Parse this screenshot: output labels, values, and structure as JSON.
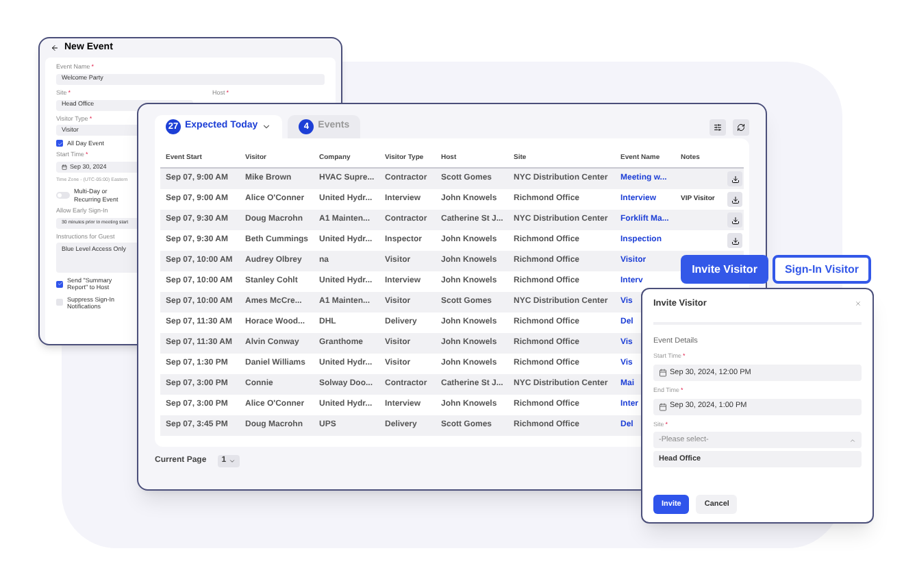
{
  "new_event": {
    "title": "New Event",
    "fields": [
      {
        "kind": "input",
        "label": "Event Name",
        "req": "*",
        "value": "Welcome Party"
      },
      {
        "kind": "pair",
        "label": "Site",
        "req": "*",
        "value": "Head Office",
        "label_2": "Host",
        "req_2": "*"
      },
      {
        "kind": "input",
        "label": "Visitor Type",
        "req": "*",
        "value": "Visitor"
      },
      {
        "kind": "checkbox",
        "label": "All Day Event",
        "checked": true
      },
      {
        "kind": "date",
        "label": "Start Time",
        "req": "*",
        "value": "Sep 30, 2024"
      },
      {
        "kind": "note",
        "label": "Time Zone - (UTC-05:00) Eastern"
      },
      {
        "kind": "toggle",
        "label": "Multi-Day or Recurring Event",
        "on": false
      },
      {
        "kind": "input",
        "label": "Allow Early Sign-In",
        "value": "30 minutes prior to meeting start"
      },
      {
        "kind": "textarea",
        "label": "Instructions for Guest",
        "value": "Blue Level Access Only"
      },
      {
        "kind": "checkbox",
        "label": "Send \"Summary Report\" to Host",
        "checked": true
      },
      {
        "kind": "checkbox",
        "label": "Suppress Sign-In Notifications",
        "checked": false
      }
    ]
  },
  "events_table": {
    "tabs": [
      {
        "count": "27",
        "label": "Expected Today",
        "selected": true
      },
      {
        "count": "4",
        "label": "Events",
        "selected": false
      }
    ],
    "columns": [
      "Event Start",
      "Visitor",
      "Company",
      "Visitor Type",
      "Host",
      "Site",
      "Event Name",
      "Notes"
    ],
    "rows": [
      {
        "cells": [
          "Sep 07, 9:00 AM",
          "Mike Brown",
          "HVAC Supre...",
          "Contractor",
          "Scott Gomes",
          "NYC Distribution Center",
          "Meeting w...",
          ""
        ],
        "download": true
      },
      {
        "cells": [
          "Sep 07, 9:00 AM",
          "Alice O'Conner",
          "United Hydr...",
          "Interview",
          "John Knowels",
          "Richmond Office",
          "Interview",
          "VIP Visitor"
        ],
        "download": true
      },
      {
        "cells": [
          "Sep 07, 9:30 AM",
          "Doug Macrohn",
          "A1 Mainten...",
          "Contractor",
          "Catherine St J...",
          "NYC Distribution Center",
          "Forklift Ma...",
          ""
        ],
        "download": true
      },
      {
        "cells": [
          "Sep 07, 9:30 AM",
          "Beth Cummings",
          "United Hydr...",
          "Inspector",
          "John Knowels",
          "Richmond Office",
          "Inspection",
          ""
        ],
        "download": true
      },
      {
        "cells": [
          "Sep 07, 10:00 AM",
          "Audrey Olbrey",
          "na",
          "Visitor",
          "John Knowels",
          "Richmond Office",
          "Visitor",
          ""
        ],
        "download": false
      },
      {
        "cells": [
          "Sep 07, 10:00 AM",
          "Stanley Cohlt",
          "United Hydr...",
          "Interview",
          "John Knowels",
          "Richmond Office",
          "Interv",
          ""
        ],
        "download": false
      },
      {
        "cells": [
          "Sep 07, 10:00 AM",
          "Ames McCre...",
          "A1 Mainten...",
          "Visitor",
          "Scott Gomes",
          "NYC Distribution Center",
          "Vis",
          ""
        ],
        "download": false
      },
      {
        "cells": [
          "Sep 07, 11:30 AM",
          "Horace Wood...",
          "DHL",
          "Delivery",
          "John Knowels",
          "Richmond Office",
          "Del",
          ""
        ],
        "download": false
      },
      {
        "cells": [
          "Sep 07, 11:30 AM",
          "Alvin Conway",
          "Granthome",
          "Visitor",
          "John Knowels",
          "Richmond Office",
          "Vis",
          ""
        ],
        "download": false
      },
      {
        "cells": [
          "Sep 07, 1:30 PM",
          "Daniel Williams",
          "United Hydr...",
          "Visitor",
          "John Knowels",
          "Richmond Office",
          "Vis",
          ""
        ],
        "download": false
      },
      {
        "cells": [
          "Sep 07, 3:00 PM",
          "Connie",
          "Solway Doo...",
          "Contractor",
          "Catherine St J...",
          "NYC Distribution Center",
          "Mai",
          ""
        ],
        "download": false
      },
      {
        "cells": [
          "Sep 07, 3:00 PM",
          "Alice O'Conner",
          "United Hydr...",
          "Interview",
          "John Knowels",
          "Richmond Office",
          "Inter",
          ""
        ],
        "download": false
      },
      {
        "cells": [
          "Sep 07, 3:45 PM",
          "Doug Macrohn",
          "UPS",
          "Delivery",
          "Scott Gomes",
          "Richmond Office",
          "Del",
          ""
        ],
        "download": false
      }
    ],
    "pagination": {
      "label": "Current Page",
      "value": "1"
    }
  },
  "actions": [
    "Invite Visitor",
    "Sign-In Visitor"
  ],
  "invite_dialog": {
    "title": "Invite Visitor",
    "section": "Event Details",
    "fields": [
      {
        "kind": "date",
        "label": "Start Time",
        "req": "*",
        "value": "Sep 30, 2024, 12:00 PM"
      },
      {
        "kind": "date",
        "label": "End Time",
        "req": "*",
        "value": "Sep 30, 2024, 1:00 PM"
      },
      {
        "kind": "select",
        "label": "Site",
        "req": "*",
        "placeholder": "-Please select-",
        "option": "Head Office"
      }
    ],
    "buttons": [
      "Invite",
      "Cancel"
    ]
  }
}
